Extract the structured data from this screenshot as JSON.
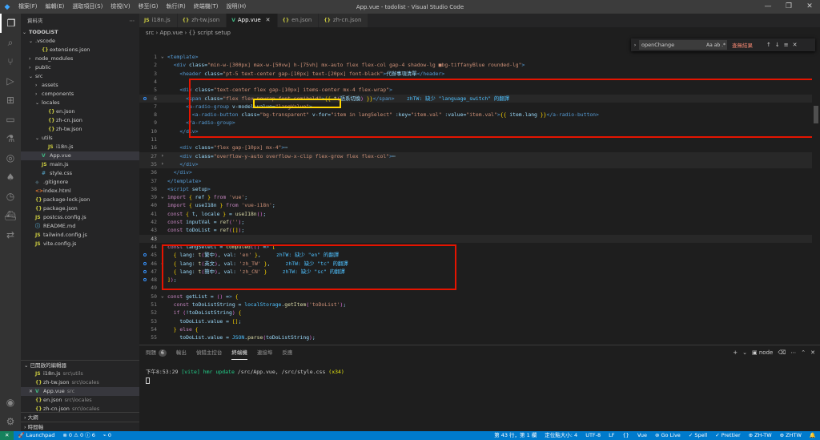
{
  "window": {
    "title": "App.vue - todolist - Visual Studio Code",
    "menu": [
      "檔案(F)",
      "編輯(E)",
      "選取項目(S)",
      "檢視(V)",
      "移至(G)",
      "執行(R)",
      "終端機(T)",
      "說明(H)"
    ],
    "controls": [
      "—",
      "❐",
      "✕"
    ]
  },
  "activity_bar": {
    "icons": [
      "files-icon",
      "search-icon",
      "source-control-icon",
      "run-debug-icon",
      "extensions-icon",
      "remote-explorer-icon",
      "testing-icon",
      "gitlens-icon",
      "mongodb-icon",
      "timeline-icon",
      "docker-icon",
      "live-share-icon"
    ],
    "bottom_icons": [
      "account-icon",
      "manage-icon"
    ]
  },
  "sidebar": {
    "header": "資料夾",
    "root": "TODOLIST",
    "tree": [
      {
        "label": ".vscode",
        "depth": 1,
        "type": "folder",
        "open": true
      },
      {
        "label": "extensions.json",
        "depth": 2,
        "type": "json"
      },
      {
        "label": "node_modules",
        "depth": 1,
        "type": "folder",
        "open": false
      },
      {
        "label": "public",
        "depth": 1,
        "type": "folder",
        "open": false
      },
      {
        "label": "src",
        "depth": 1,
        "type": "folder",
        "open": true
      },
      {
        "label": "assets",
        "depth": 2,
        "type": "folder",
        "open": false
      },
      {
        "label": "components",
        "depth": 2,
        "type": "folder",
        "open": false
      },
      {
        "label": "locales",
        "depth": 2,
        "type": "folder",
        "open": true
      },
      {
        "label": "en.json",
        "depth": 3,
        "type": "json"
      },
      {
        "label": "zh-cn.json",
        "depth": 3,
        "type": "json"
      },
      {
        "label": "zh-tw.json",
        "depth": 3,
        "type": "json"
      },
      {
        "label": "utils",
        "depth": 2,
        "type": "folder",
        "open": true
      },
      {
        "label": "i18n.js",
        "depth": 3,
        "type": "js"
      },
      {
        "label": "App.vue",
        "depth": 2,
        "type": "vue",
        "selected": true
      },
      {
        "label": "main.js",
        "depth": 2,
        "type": "js"
      },
      {
        "label": "style.css",
        "depth": 2,
        "type": "css"
      },
      {
        "label": ".gitignore",
        "depth": 1,
        "type": "git"
      },
      {
        "label": "index.html",
        "depth": 1,
        "type": "html"
      },
      {
        "label": "package-lock.json",
        "depth": 1,
        "type": "json"
      },
      {
        "label": "package.json",
        "depth": 1,
        "type": "json"
      },
      {
        "label": "postcss.config.js",
        "depth": 1,
        "type": "js"
      },
      {
        "label": "README.md",
        "depth": 1,
        "type": "md"
      },
      {
        "label": "tailwind.config.js",
        "depth": 1,
        "type": "js"
      },
      {
        "label": "vite.config.js",
        "depth": 1,
        "type": "js"
      }
    ],
    "open_editors_header": "已開啟的編輯器",
    "open_editors": [
      {
        "label": "i18n.js",
        "desc": "src\\utils",
        "type": "js"
      },
      {
        "label": "zh-tw.json",
        "desc": "src\\locales",
        "type": "json"
      },
      {
        "label": "App.vue",
        "desc": "src",
        "type": "vue",
        "active": true
      },
      {
        "label": "en.json",
        "desc": "src\\locales",
        "type": "json"
      },
      {
        "label": "zh-cn.json",
        "desc": "src\\locales",
        "type": "json"
      }
    ],
    "outline_header": "大綱",
    "timeline_header": "時間軸"
  },
  "tabs": [
    {
      "label": "i18n.js",
      "type": "js"
    },
    {
      "label": "zh-tw.json",
      "type": "json"
    },
    {
      "label": "App.vue",
      "type": "vue",
      "active": true
    },
    {
      "label": "en.json",
      "type": "json"
    },
    {
      "label": "zh-cn.json",
      "type": "json"
    }
  ],
  "breadcrumb": "src  ›  App.vue  ›  {} script setup",
  "find": {
    "query": "openChange",
    "options": "Aa  ab  .*",
    "result": "查無結果",
    "up": "↑",
    "down": "↓",
    "menu": "≡",
    "close": "✕"
  },
  "code_lines": [
    {
      "n": "1",
      "text": "<template>"
    },
    {
      "n": "2",
      "text": "  <div class=\"min-w-[300px] max-w-[50vw] h-[75vh] mx-auto flex flex-col gap-4 shadow-lg ■bg-tiffanyBlue rounded-lg\">"
    },
    {
      "n": "3",
      "text": "    <header class=\"pt-5 text-center gap-[10px] text-[20px] font-black\">代辦事項清單</header>"
    },
    {
      "n": "4",
      "text": ""
    },
    {
      "n": "5",
      "text": "    <div class=\"text-center flex gap-[10px] items-center mx-4 flex-wrap\">"
    },
    {
      "n": "6",
      "text": "      <span class=\"flex flex-nowrap font-semibold\">{{ t(語系切換) }}</span>    zhTW: 缺少 \"language_switch\" 的翻譯"
    },
    {
      "n": "7",
      "text": "      <a-radio-group v-model:value=\"langValue\">"
    },
    {
      "n": "8",
      "text": "        <a-radio-button class=\"bg-transparent\" v-for=\"item in langSelect\" :key=\"item.val\" :value=\"item.val\">{{ item.lang }}</a-radio-button>"
    },
    {
      "n": "9",
      "text": "      </a-radio-group>"
    },
    {
      "n": "10",
      "text": "    </div>"
    },
    {
      "n": "11",
      "text": ""
    },
    {
      "n": "16",
      "text": "    <div class=\"flex gap-[10px] mx-4\">⋯"
    },
    {
      "n": "27",
      "text": "    <div class=\"overflow-y-auto overflow-x-clip flex-grow flex flex-col\">⋯"
    },
    {
      "n": "35",
      "text": "    </div>"
    },
    {
      "n": "36",
      "text": "  </div>"
    },
    {
      "n": "37",
      "text": "</template>"
    },
    {
      "n": "38",
      "text": "<script setup>"
    },
    {
      "n": "39",
      "text": "import { ref } from 'vue';"
    },
    {
      "n": "40",
      "text": "import { useI18n } from 'vue-i18n';"
    },
    {
      "n": "41",
      "text": "const { t, locale } = useI18n();"
    },
    {
      "n": "42",
      "text": "const inputVal = ref('');"
    },
    {
      "n": "43",
      "text": "const toDoList = ref([]);"
    },
    {
      "n": "43",
      "text": ""
    },
    {
      "n": "44",
      "text": "const langSelect = computed(() => ["
    },
    {
      "n": "45",
      "text": "  { lang: t(繁中), val: 'en' },     zhTW: 缺少 \"en\" 的翻譯"
    },
    {
      "n": "46",
      "text": "  { lang: t(英文), val: 'zh_TW' },     zhTW: 缺少 \"tc\" 的翻譯"
    },
    {
      "n": "47",
      "text": "  { lang: t(簡中), val: 'zh_CN' }     zhTW: 缺少 \"sc\" 的翻譯"
    },
    {
      "n": "48",
      "text": "]);"
    },
    {
      "n": "49",
      "text": ""
    },
    {
      "n": "50",
      "text": "const getList = () => {"
    },
    {
      "n": "51",
      "text": "  const toDoListString = localStorage.getItem('toDoList');"
    },
    {
      "n": "52",
      "text": "  if (!toDoListString) {"
    },
    {
      "n": "53",
      "text": "    toDoList.value = [];"
    },
    {
      "n": "54",
      "text": "  } else {"
    },
    {
      "n": "55",
      "text": "    toDoList.value = JSON.parse(toDoListString);"
    }
  ],
  "panel": {
    "tabs": [
      "問題",
      "輸出",
      "偵錯主控台",
      "終端機",
      "連接埠",
      "反應"
    ],
    "problems_count": "6",
    "active_tab": "終端機",
    "terminal_name": "node",
    "actions": [
      "+",
      "⌄",
      "🗑",
      "⋯",
      "⌃",
      "✕"
    ],
    "terminal_line_time": "下午8:53:29",
    "terminal_line_tag": "[vite]",
    "terminal_line_msg": "hmr update /src/App.vue, /src/style.css",
    "terminal_line_count": "(x34)"
  },
  "statusbar": {
    "remote": "✕",
    "launchpad": "Launchpad",
    "errors": "⊗ 0 ⚠ 0 ⓘ 6",
    "ports": "⌁ 0",
    "position": "第 43 行，第 1 欄",
    "indent": "定位點大小: 4",
    "encoding": "UTF-8",
    "eol": "LF",
    "braces": "{}",
    "language": "Vue",
    "golive": "Go Live",
    "spell": "✓ Spell",
    "prettier": "✓ Prettier",
    "locale1": "ZH-TW",
    "locale2": "ZHTW",
    "bell": "🔔"
  }
}
